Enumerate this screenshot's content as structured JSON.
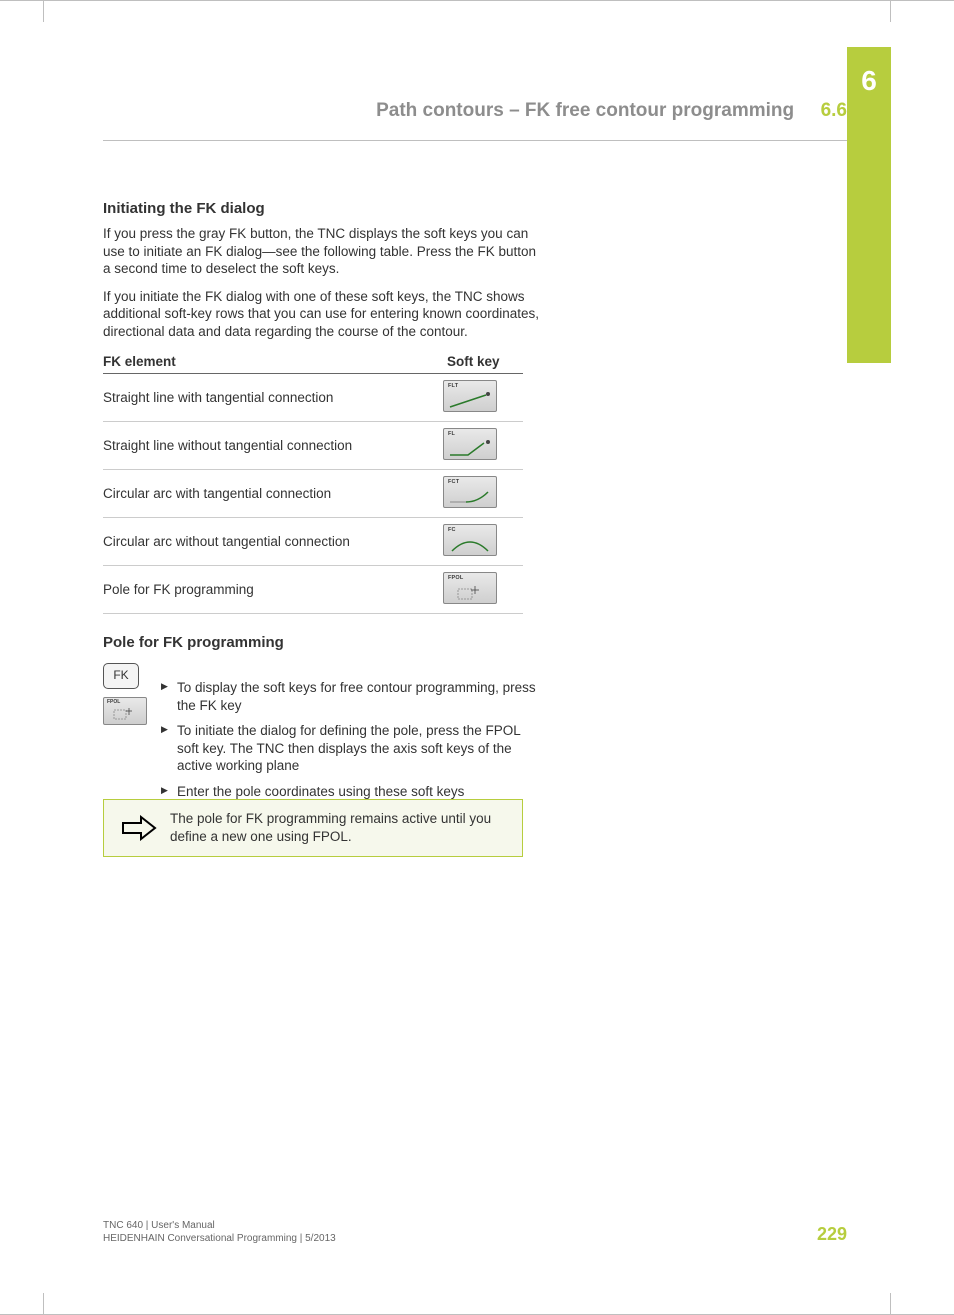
{
  "chapter_tab": "6",
  "header": {
    "title": "Path contours – FK free contour programming",
    "section_number": "6.6"
  },
  "section1": {
    "heading": "Initiating the FK dialog",
    "para1": "If you press the gray FK button, the TNC displays the soft keys you can use to initiate an FK dialog—see the following table. Press the FK button a second time to deselect the soft keys.",
    "para2": "If you initiate the FK dialog with one of these soft keys, the TNC shows additional soft-key rows that you can use for entering known coordinates, directional data and data regarding the course of the contour."
  },
  "table": {
    "col1": "FK element",
    "col2": "Soft key",
    "rows": [
      {
        "desc": "Straight line with tangential connection",
        "key": "FLT"
      },
      {
        "desc": "Straight line without tangential connection",
        "key": "FL"
      },
      {
        "desc": "Circular arc with tangential connection",
        "key": "FCT"
      },
      {
        "desc": "Circular arc without tangential connection",
        "key": "FC"
      },
      {
        "desc": "Pole for FK programming",
        "key": "FPOL"
      }
    ]
  },
  "section2": {
    "heading": "Pole for FK programming",
    "fk_key_label": "FK",
    "fpol_key_label": "FPOL",
    "steps": [
      "To display the soft keys for free contour programming, press the FK key",
      "To initiate the dialog for defining the pole, press the FPOL soft key. The TNC then displays the axis soft keys of the active working plane",
      "Enter the pole coordinates using these soft keys"
    ]
  },
  "note_text": "The pole for FK programming remains active until you define a new one using FPOL.",
  "footer": {
    "line1": "TNC 640 | User's Manual",
    "line2": "HEIDENHAIN Conversational Programming | 5/2013",
    "page": "229"
  }
}
